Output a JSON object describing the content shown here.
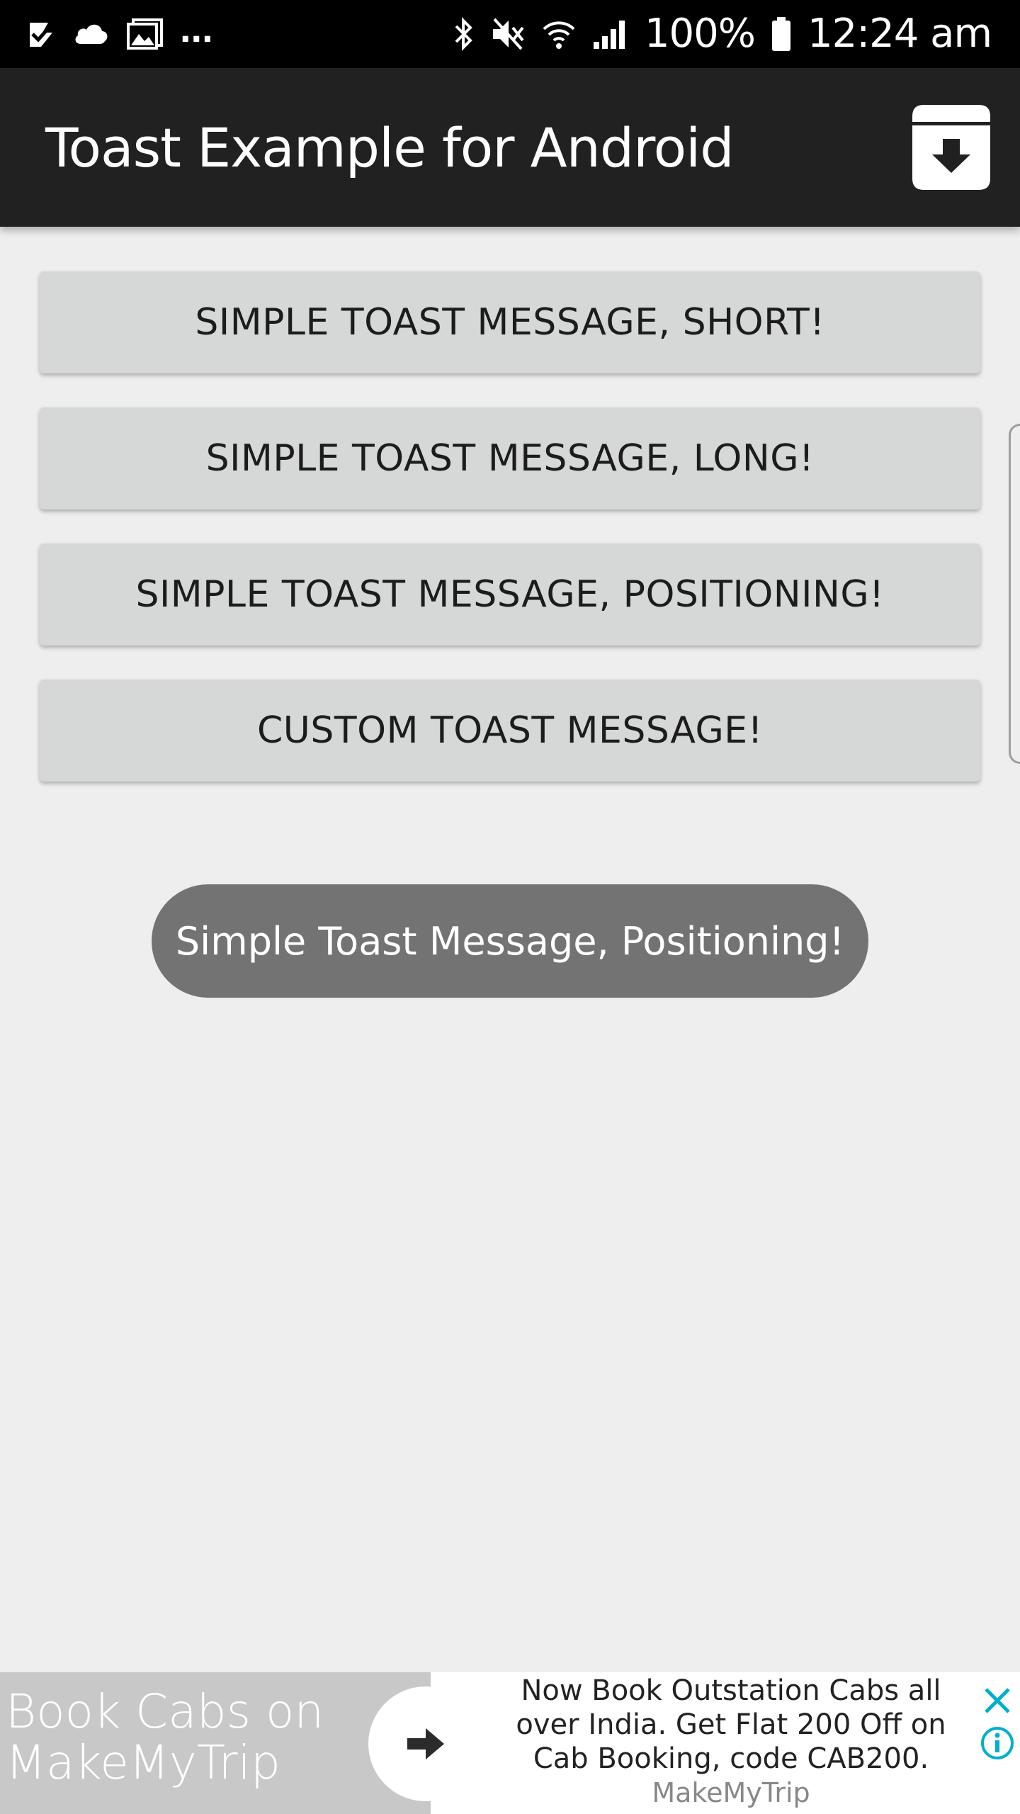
{
  "status_bar": {
    "notification_icons": [
      "check-flag-icon",
      "cloud-icon",
      "gallery-icon"
    ],
    "more": "...",
    "system_icons": [
      "bluetooth-icon",
      "vibrate-mute-icon",
      "wifi-icon",
      "signal-icon",
      "battery-icon"
    ],
    "battery": "100%",
    "time": "12:24 am"
  },
  "app_bar": {
    "title": "Toast Example for Android",
    "action_icon": "archive-download-icon"
  },
  "buttons": {
    "short": "SIMPLE TOAST MESSAGE, SHORT!",
    "long": "SIMPLE TOAST MESSAGE, LONG!",
    "positioning": "SIMPLE TOAST MESSAGE, POSITIONING!",
    "custom": "CUSTOM TOAST MESSAGE!"
  },
  "toast": {
    "message": "Simple Toast Message, Positioning!"
  },
  "ad": {
    "headline": "Book Cabs on MakeMyTrip",
    "cta_icon": "arrow-right-icon",
    "body": "Now Book Outstation Cabs all over India. Get Flat 200 Off on Cab Booking, code CAB200.",
    "advertiser": "MakeMyTrip",
    "close_icon": "close-icon",
    "info_icon": "info-icon",
    "accent_color": "#00aecd"
  },
  "colors": {
    "status_bar": "#000000",
    "app_bar": "#212121",
    "background": "#eeeeee",
    "button": "#d6d7d7",
    "toast": "#737373"
  }
}
